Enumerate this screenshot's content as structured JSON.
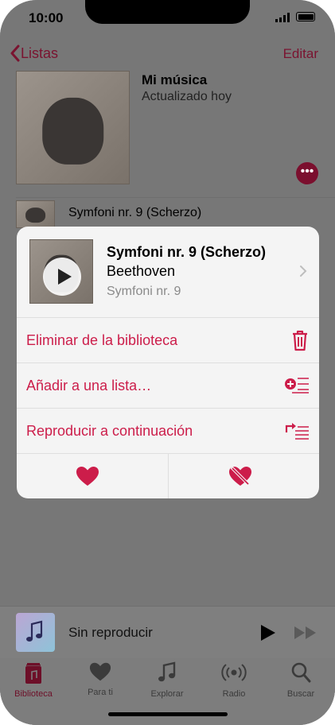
{
  "status": {
    "time": "10:00"
  },
  "nav": {
    "back_label": "Listas",
    "edit_label": "Editar"
  },
  "playlist": {
    "title": "Mi música",
    "subtitle": "Actualizado hoy"
  },
  "song_row": {
    "title": "Symfoni nr. 9 (Scherzo)"
  },
  "card": {
    "title": "Symfoni nr. 9 (Scherzo)",
    "artist": "Beethoven",
    "album": "Symfoni nr. 9",
    "actions": [
      {
        "label": "Eliminar de la biblioteca",
        "icon": "trash-icon"
      },
      {
        "label": "Añadir a una lista…",
        "icon": "add-to-list-icon"
      },
      {
        "label": "Reproducir a continuación",
        "icon": "play-next-icon"
      }
    ]
  },
  "mini_player": {
    "text": "Sin reproducir"
  },
  "tabs": [
    {
      "label": "Biblioteca",
      "icon": "library-icon",
      "active": true
    },
    {
      "label": "Para ti",
      "icon": "heart-icon",
      "active": false
    },
    {
      "label": "Explorar",
      "icon": "music-note-icon",
      "active": false
    },
    {
      "label": "Radio",
      "icon": "radio-icon",
      "active": false
    },
    {
      "label": "Buscar",
      "icon": "search-icon",
      "active": false
    }
  ],
  "colors": {
    "accent": "#CC1D4A",
    "accent_dim": "#7B0F2E"
  }
}
